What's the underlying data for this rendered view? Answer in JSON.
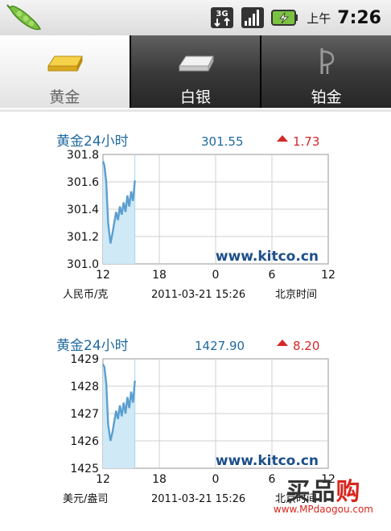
{
  "status_bar": {
    "network": "3G",
    "time_prefix": "上午",
    "time": "7:26",
    "icons": [
      "app-pea-icon",
      "3g-data-icon",
      "signal-icon",
      "battery-charging-icon"
    ]
  },
  "tabs": [
    {
      "label": "黄金",
      "icon": "gold-bar-icon",
      "active": true
    },
    {
      "label": "白银",
      "icon": "silver-bar-icon",
      "active": false
    },
    {
      "label": "铂金",
      "icon": "platinum-icon",
      "active": false
    }
  ],
  "chart_data": [
    {
      "type": "line",
      "title": "黄金24小时",
      "price": "301.55",
      "change": "1.73",
      "change_direction": "up",
      "y_ticks": [
        "301.8",
        "301.6",
        "301.4",
        "301.2",
        "301.0"
      ],
      "ylim": [
        301.0,
        301.8
      ],
      "x_ticks": [
        "12",
        "18",
        "0",
        "6",
        "12"
      ],
      "unit_label": "人民币/克",
      "timestamp": "2011-03-21 15:26",
      "tz_label": "北京时间",
      "watermark": "www.kitco.cn",
      "x": [
        0,
        0.15,
        0.35,
        0.55,
        0.8,
        1.0,
        1.2,
        1.4,
        1.6,
        1.8,
        2.0,
        2.2,
        2.4,
        2.6,
        2.8,
        3.0,
        3.2,
        3.4
      ],
      "y": [
        301.75,
        301.72,
        301.6,
        301.3,
        301.15,
        301.22,
        301.3,
        301.38,
        301.32,
        301.42,
        301.36,
        301.45,
        301.38,
        301.5,
        301.42,
        301.53,
        301.46,
        301.61
      ],
      "color": "#5b9fd0",
      "fill_color": "#cfe9f6",
      "grid": true
    },
    {
      "type": "line",
      "title": "黄金24小时",
      "price": "1427.90",
      "change": "8.20",
      "change_direction": "up",
      "y_ticks": [
        "1429",
        "1428",
        "1427",
        "1426",
        "1425"
      ],
      "ylim": [
        1425,
        1429
      ],
      "x_ticks": [
        "12",
        "18",
        "0",
        "6",
        "12"
      ],
      "unit_label": "美元/盎司",
      "timestamp": "2011-03-21 15:26",
      "tz_label": "北京时间",
      "watermark": "www.kitco.cn",
      "x": [
        0,
        0.15,
        0.35,
        0.55,
        0.8,
        1.0,
        1.2,
        1.4,
        1.6,
        1.8,
        2.0,
        2.2,
        2.4,
        2.6,
        2.8,
        3.0,
        3.2,
        3.4
      ],
      "y": [
        1428.8,
        1428.7,
        1428.1,
        1426.6,
        1426.0,
        1426.3,
        1426.7,
        1427.1,
        1426.8,
        1427.3,
        1426.9,
        1427.4,
        1427.0,
        1427.6,
        1427.2,
        1427.8,
        1427.4,
        1428.2
      ],
      "color": "#5b9fd0",
      "fill_color": "#cfe9f6",
      "grid": true
    }
  ],
  "site_watermark": {
    "logo_part1": "买品",
    "logo_part2": "购",
    "url": "www.MPdaogou.com"
  }
}
